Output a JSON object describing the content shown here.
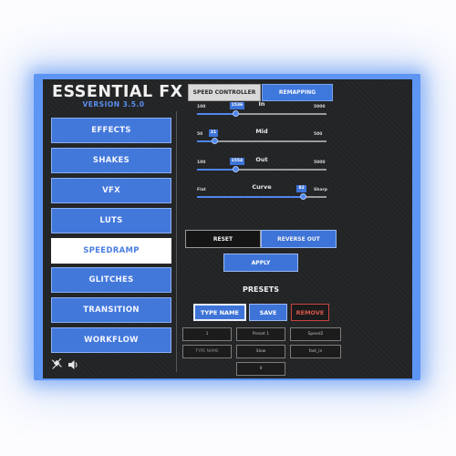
{
  "app": {
    "title": "ESSENTIAL FX",
    "version": "VERSION 3.5.0"
  },
  "tabs": [
    {
      "label": "SPEED CONTROLLER",
      "active": true
    },
    {
      "label": "REMAPPING",
      "active": false
    }
  ],
  "nav": [
    {
      "label": "EFFECTS"
    },
    {
      "label": "SHAKES"
    },
    {
      "label": "VFX"
    },
    {
      "label": "LUTS"
    },
    {
      "label": "SPEEDRAMP",
      "active": true
    },
    {
      "label": "GLITCHES"
    },
    {
      "label": "TRANSITION"
    },
    {
      "label": "WORKFLOW"
    }
  ],
  "sliders": [
    {
      "label": "In",
      "min_label": "100",
      "max_label": "5000",
      "value": "1536",
      "fraction": 0.3
    },
    {
      "label": "Mid",
      "min_label": "50",
      "max_label": "500",
      "value": "21",
      "fraction": 0.14
    },
    {
      "label": "Out",
      "min_label": "100",
      "max_label": "5000",
      "value": "1554",
      "fraction": 0.3
    },
    {
      "label": "Curve",
      "min_label": "Flat",
      "max_label": "Sharp",
      "value": "82",
      "fraction": 0.82
    }
  ],
  "actions": {
    "reset": "RESET",
    "reverse_out": "REVERSE OUT",
    "apply": "APPLY"
  },
  "presets": {
    "heading": "PRESETS",
    "type_name": "TYPE NAME",
    "save": "SAVE",
    "remove": "REMOVE",
    "slots": [
      {
        "label": "1"
      },
      {
        "label": "Preset 1"
      },
      {
        "label": "Speed2"
      },
      {
        "label": "TYPE NAME"
      },
      {
        "label": "Slow"
      },
      {
        "label": "fast_in"
      },
      {
        "label": "0"
      }
    ]
  },
  "icons": [
    "satellite-icon",
    "speaker-icon"
  ],
  "colors": {
    "accent": "#4378db",
    "glow": "#5d95f3",
    "panel": "#222325",
    "remove": "#d9554d"
  }
}
